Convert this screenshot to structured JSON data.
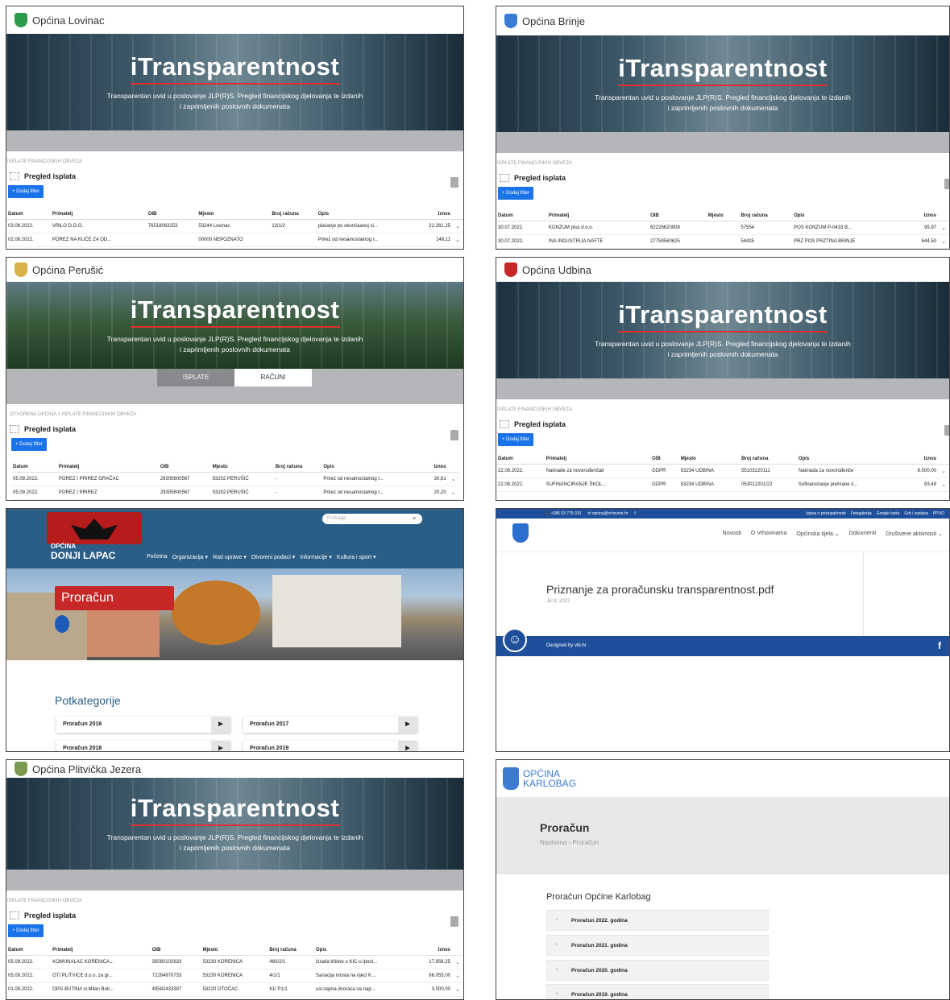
{
  "common": {
    "banner_title": "iTransparentnost",
    "banner_sub": "Transparentan uvid u poslovanje JLP(R)S. Pregled financijskog djelovanja te izdanih i zaprimljenih poslovnih dokumenata",
    "crumb": "ISPLATE FINANCIJSKIH OBVEZA",
    "section": "Pregled isplata",
    "filter": "+ Dodaj filter",
    "cols": [
      "Datum",
      "Primatelj",
      "OIB",
      "Mjesto",
      "Broj računa",
      "Opis",
      "Iznos"
    ]
  },
  "lovinac": {
    "name": "Općina Lovinac",
    "rows": [
      [
        "03.08.2022.",
        "VRILO D.O.O.",
        "76518063253",
        "53244 Lovinac",
        "13/1/2",
        "plaćanje po okončaanoj si...",
        "22.261,25"
      ],
      [
        "02.08.2022.",
        "POREZ NA KUĆE ZA OD...",
        "",
        "00000 NEPOZNATO",
        "",
        "Prirez od nesamostalnog r...",
        "148,11"
      ]
    ]
  },
  "brinje": {
    "name": "Općina Brinje",
    "rows": [
      [
        "30.07.2022.",
        "KONZUM plus d.o.o.",
        "62226620908",
        "",
        "57554",
        "POS KONZUM P-0433 B...",
        "95,97"
      ],
      [
        "30.07.2022.",
        "INA INDUSTRIJA NAFTE",
        "27759560625",
        "",
        "54425",
        "PRZ POS PRZTINA BRINJE",
        "644,50"
      ]
    ]
  },
  "perusic": {
    "name": "Općina Perušić",
    "tabs": [
      "ISPLATE",
      "RAČUNI"
    ],
    "crumb": "OTVORENA OPĆINA  >  ISPLATE FINANCIJSKIH OBVEZA",
    "rows": [
      [
        "05.09.2022.",
        "POREZ I PRIREZ GRAČAC",
        "29305600567",
        "53202 PERUŠIĆ",
        "-",
        "Prirez od nesamostalnog r...",
        "30,61"
      ],
      [
        "05.09.2022.",
        "POREZ I PRIREZ",
        "29305600567",
        "53202 PERUŠIĆ",
        "-",
        "Prirez od nesamostalnog r...",
        "20,20"
      ]
    ]
  },
  "udbina": {
    "name": "Općina Udbina",
    "rows": [
      [
        "22.08.2022.",
        "Naknade za novorođenčad",
        "GDPR",
        "53234 UDBINA",
        "55103220111",
        "Naknada za novorođenče",
        "6.000,00"
      ],
      [
        "22.08.2022.",
        "SUFINANCIRANJE ŠKOL...",
        "GDPR",
        "53234 UDBINA",
        "053012201/22",
        "Sufinanciranje prehrane š...",
        "83,49"
      ]
    ]
  },
  "lapac": {
    "name_a": "OPĆINA",
    "name_b": "DONJI LAPAC",
    "search": "Pretraga",
    "nav": [
      "Početna",
      "Organizacija ▾",
      "Rad uprave ▾",
      "Otvoreni podaci ▾",
      "Informacije ▾",
      "Kultura i sport ▾"
    ],
    "hero": "Proračun",
    "potk": "Potkategorije",
    "subs": [
      "Proračun 2016",
      "Proračun 2017",
      "Proračun 2018",
      "Proračun 2019"
    ]
  },
  "vrhovine": {
    "phone": "📞 +385 53 775 010",
    "email": "✉ opcina@vrhovine.hr",
    "fb": "f",
    "top": [
      "Izjava o pristupačnosti",
      "Fotogalerija",
      "Google karta",
      "Grb i zastava",
      "PPUO"
    ],
    "nav": [
      "Novosti",
      "O Vrhovinama",
      "Općinska tijela ⌄",
      "Dokumenti",
      "Društvene aktivnosti ⌄"
    ],
    "doc": "Priznanje za proračunsku transparentnost.pdf",
    "date": "Jul 8, 2022",
    "designed": "Designed by vib.hr"
  },
  "plitvice": {
    "name": "Općina Plitvička Jezera",
    "rows": [
      [
        "05.09.2022.",
        "KOMUNALAC KORENICA...",
        "35080102633",
        "53230 KORENICA",
        "460/2/1",
        "Izrada tribine u KIC-u ipost...",
        "17.956,25"
      ],
      [
        "05.09.2022.",
        "GTI PLITVICE d.o.o. za gr...",
        "72284970733",
        "53230 KORENICA",
        "4/1/1",
        "Sanacija mosta na rijeci K...",
        "66.055,00"
      ],
      [
        "01.09.2022.",
        "OPG BUTINA vl.Milan Buti...",
        "49582433397",
        "53220 OTOČAC",
        "61/ P1/1",
        "usl.najma dvoraca na nap...",
        "3.000,00"
      ]
    ]
  },
  "karlobag": {
    "name_a": "OPĆINA",
    "name_b": "KARLOBAG",
    "title": "Proračun",
    "bc": "Naslovna   ›   Proračun",
    "sub": "Proračun Općine Karlobag",
    "items": [
      "Proračun 2022. godina",
      "Proračun 2021. godina",
      "Proračun 2020. godina",
      "Proračun 2019. godina"
    ]
  }
}
